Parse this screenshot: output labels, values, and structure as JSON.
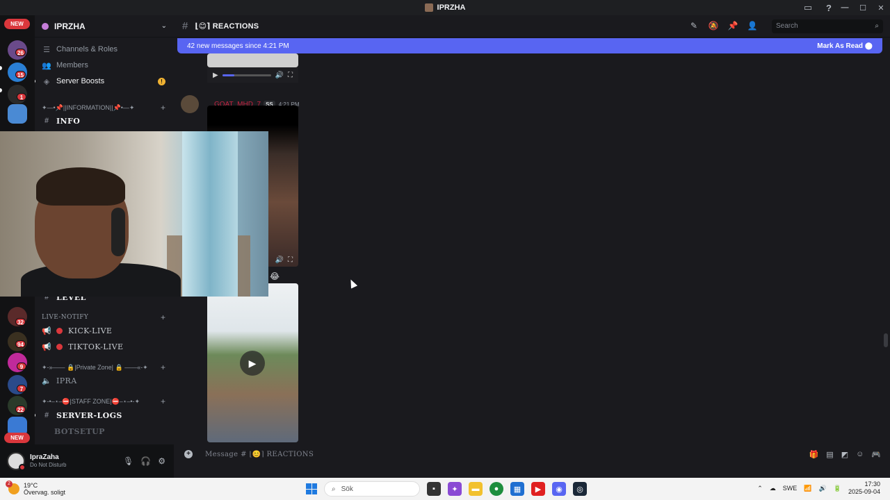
{
  "window": {
    "title": "IPRZHA",
    "controls": [
      "—",
      "☐",
      "✕"
    ]
  },
  "server": {
    "name": "IPRZHA"
  },
  "guild_badges": [
    "26",
    "15",
    "1",
    "32",
    "94",
    "9",
    "7",
    "22"
  ],
  "guild_new_top": "NEW",
  "guild_new_bottom": "NEW",
  "sidebar": {
    "channels_roles": "Channels & Roles",
    "members": "Members",
    "server_boosts": "Server Boosts",
    "cat_information": "✦—•📌||INFORMATION||📌•—✦",
    "info": "INFO",
    "level": "LEVEL",
    "cat_live_notify": "LIVE-NOTIFY",
    "kick_live": "KICK-LIVE",
    "tiktok_live": "TIKTOK-LIVE",
    "cat_private": "✦-»—— 🔒|Private Zone| 🔒 ——«-✦",
    "ipra": "IPRA",
    "cat_staff": "✦-•–⋆–⛔|STAFF ZONE|⛔–⋆–•-✦",
    "server_logs": "SERVER-LOGS",
    "botsetup": "BOTSETUP"
  },
  "user": {
    "name": "IpraZaha",
    "status": "Do Not Disturb"
  },
  "channel": {
    "name": "REACTIONS"
  },
  "search": {
    "placeholder": "Search"
  },
  "new_messages": {
    "text": "42 new messages since 4:21 PM",
    "mark_read": "Mark As Read"
  },
  "message": {
    "author": "GOAT_MHD_7",
    "tag": "SS",
    "time": "4:21 PM"
  },
  "composer": {
    "placeholder": "Message #  ⌊😊⌉  REACTIONS"
  },
  "taskbar": {
    "temp": "19°C",
    "weather": "Övervag. soligt",
    "weather_badge": "2",
    "search": "Sök",
    "lang": "SWE",
    "time": "17:30",
    "date": "2025-09-04"
  },
  "colors": {
    "accent": "#5865f2",
    "mention": "#da373c",
    "author": "#c22340"
  }
}
